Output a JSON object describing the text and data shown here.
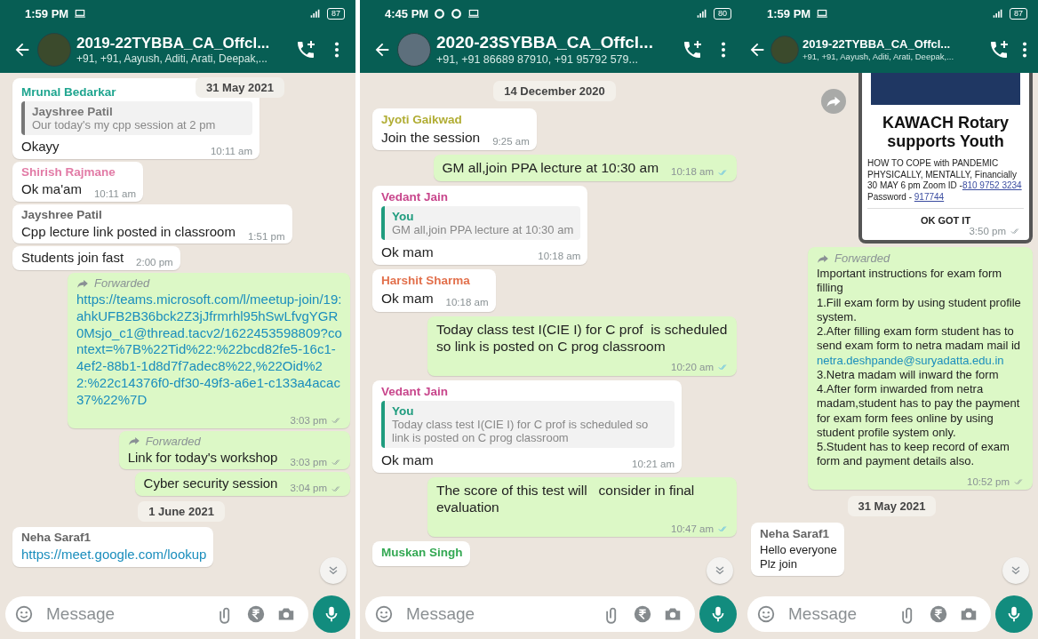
{
  "panels": [
    {
      "status": {
        "time": "1:59 PM",
        "battery": "87",
        "extra_icons": false
      },
      "header": {
        "title": "2019-22TYBBA_CA_Offcl...",
        "subtitle": "+91, +91, Aayush, Aditi, Arati, Deepak,..."
      },
      "sticky_date": "31 May 2021",
      "messages": [
        {
          "kind": "in",
          "sender": "Mrunal Bedarkar",
          "color": "#1fa58f",
          "quote": {
            "author": "Jayshree Patil",
            "text": "Our today's my cpp session at 2 pm",
            "color": "#777777"
          },
          "text": "Okayy",
          "time": "10:11 am"
        },
        {
          "kind": "in",
          "sender": "Shirish Rajmane",
          "color": "#e27ba6",
          "text": "Ok ma'am",
          "time": "10:11 am"
        },
        {
          "kind": "in",
          "sender": "Jayshree Patil",
          "color": "#666666",
          "text": "Cpp lecture link posted in classroom",
          "time": "1:51 pm"
        },
        {
          "kind": "in",
          "text": "Students join fast",
          "time": "2:00 pm"
        },
        {
          "kind": "out",
          "forwarded": "Forwarded",
          "link": true,
          "text": "https://teams.microsoft.com/l/meetup-join/19:ahkUFB2B36bck2Z3jJfrmrhl95hSwLfvgYGR0Msjo_c1@thread.tacv2/1622453598809?context=%7B%22Tid%22:%22bcd82fe5-16c1-4ef2-88b1-1d8d7f7adec8%22,%22Oid%22:%22c14376f0-df30-49f3-a6e1-c133a4acac37%22%7D",
          "time": "3:03 pm",
          "read": false
        },
        {
          "kind": "out",
          "forwarded": "Forwarded",
          "text": "Link for today's workshop",
          "time": "3:03 pm",
          "read": false
        },
        {
          "kind": "out",
          "text": "Cyber security session",
          "time": "3:04 pm",
          "read": false
        },
        {
          "kind": "date",
          "text": "1 June 2021"
        },
        {
          "kind": "in",
          "sender": "Neha Saraf1",
          "color": "#666666",
          "link": true,
          "text": "https://meet.google.com/lookup"
        }
      ],
      "placeholder": "Message"
    },
    {
      "status": {
        "time": "4:45 PM",
        "battery": "80",
        "extra_icons": true
      },
      "header": {
        "title": "2020-23SYBBA_CA_Offcl...",
        "subtitle": "+91, +91 86689 87910, +91 95792 579..."
      },
      "messages": [
        {
          "kind": "date",
          "text": "14 December 2020"
        },
        {
          "kind": "in",
          "sender": "Jyoti Gaikwad",
          "color": "#b1ad34",
          "text": "Join the session",
          "time": "9:25 am"
        },
        {
          "kind": "out",
          "text": "GM all,join PPA lecture at 10:30 am",
          "time": "10:18 am",
          "read": true
        },
        {
          "kind": "in",
          "sender": "Vedant Jain",
          "color": "#c8468c",
          "quote": {
            "author": "You",
            "text": "GM all,join PPA lecture at 10:30 am",
            "color": "#1f9c7e"
          },
          "text": "Ok mam",
          "time": "10:18 am"
        },
        {
          "kind": "in",
          "sender": "Harshit Sharma",
          "color": "#e2704c",
          "text": "Ok mam",
          "time": "10:18 am"
        },
        {
          "kind": "out",
          "text": "Today class test I(CIE I) for C prof  is scheduled so link is posted on C prog classroom",
          "time": "10:20 am",
          "read": true
        },
        {
          "kind": "in",
          "sender": "Vedant Jain",
          "color": "#c8468c",
          "quote": {
            "author": "You",
            "text": "Today class test I(CIE I) for C prof  is scheduled so link is posted on C prog classroom",
            "color": "#1f9c7e"
          },
          "text": "Ok mam",
          "time": "10:21 am"
        },
        {
          "kind": "out",
          "text": "The score of this test will   consider in final evaluation",
          "time": "10:47 am",
          "read": true
        },
        {
          "kind": "in",
          "sender": "Muskan Singh",
          "color": "#34a853"
        }
      ],
      "placeholder": "Message"
    },
    {
      "status": {
        "time": "1:59 PM",
        "battery": "87",
        "extra_icons": false
      },
      "header": {
        "title": "2019-22TYBBA_CA_Offcl...",
        "subtitle": "+91, +91, Aayush, Aditi, Arati, Deepak,..."
      },
      "messages": [
        {
          "kind": "card",
          "title": "KAWACH Rotary supports Youth",
          "body": "HOW TO COPE with PANDEMIC PHYSICALLY, MENTALLY, Financially  30 MAY 6 pm Zoom ID -",
          "zoom_id": "810 9752 3234",
          "password_label": "Password - ",
          "password": "917744",
          "button": "OK GOT IT",
          "time": "3:50 pm",
          "read": false
        },
        {
          "kind": "out",
          "forwarded": "Forwarded",
          "parts": [
            {
              "text": "Important instructions for exam form filling"
            },
            {
              "text": "1.Fill exam form by using student profile system."
            },
            {
              "text": "2.After filling exam form student has to send exam form to netra madam mail id"
            },
            {
              "text": "netra.deshpande@suryadatta.edu.in",
              "link": true
            },
            {
              "text": "3.Netra madam will inward the form"
            },
            {
              "text": "4.After form inwarded from netra madam,student has to pay the payment for exam form fees online by using student profile system only."
            },
            {
              "text": "5.Student has to keep record of  exam form and payment details also."
            }
          ],
          "time": "10:52 pm",
          "read": false
        },
        {
          "kind": "date",
          "text": "31 May 2021"
        },
        {
          "kind": "in",
          "sender": "Neha Saraf1",
          "color": "#666666",
          "text": "Hello everyone\nPlz join"
        }
      ],
      "placeholder": "Message"
    }
  ]
}
